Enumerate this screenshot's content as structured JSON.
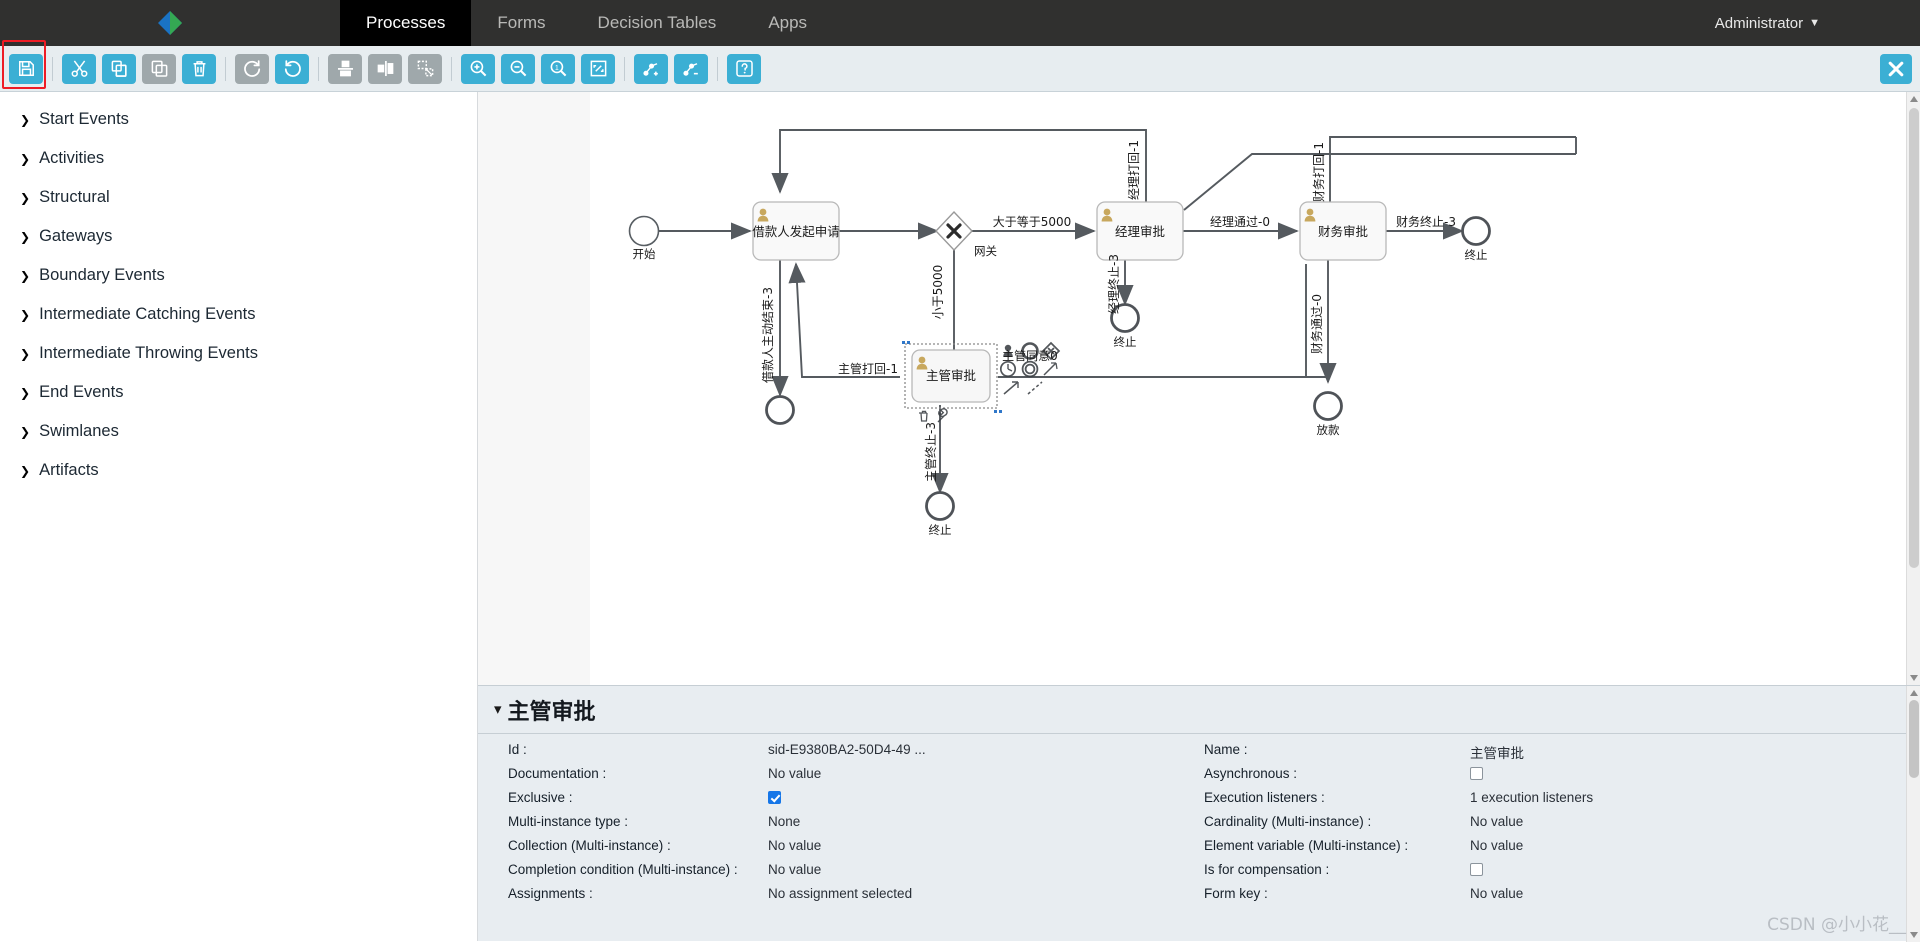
{
  "header": {
    "logo_icon": "diamond-logo-icon",
    "tabs": [
      {
        "label": "Processes",
        "active": true
      },
      {
        "label": "Forms",
        "active": false
      },
      {
        "label": "Decision Tables",
        "active": false
      },
      {
        "label": "Apps",
        "active": false
      }
    ],
    "user": "Administrator",
    "user_caret_icon": "chevron-down-icon"
  },
  "toolbar": {
    "buttons": [
      {
        "name": "save-button",
        "icon": "save-icon",
        "enabled": true,
        "title": "Save"
      },
      {
        "name": "cut-button",
        "icon": "scissors-icon",
        "enabled": true,
        "title": "Cut"
      },
      {
        "name": "copy-button",
        "icon": "copy-icon",
        "enabled": true,
        "title": "Copy"
      },
      {
        "name": "paste-button",
        "icon": "paste-icon",
        "enabled": false,
        "title": "Paste"
      },
      {
        "name": "delete-button",
        "icon": "trash-icon",
        "enabled": true,
        "title": "Delete"
      },
      {
        "name": "redo-button",
        "icon": "redo-icon",
        "enabled": false,
        "title": "Redo"
      },
      {
        "name": "undo-button",
        "icon": "undo-icon",
        "enabled": true,
        "title": "Undo"
      },
      {
        "name": "align-vertical-button",
        "icon": "align-vertical-icon",
        "enabled": false,
        "title": "Align vertical"
      },
      {
        "name": "align-horizontal-button",
        "icon": "align-horizontal-icon",
        "enabled": false,
        "title": "Align horizontal"
      },
      {
        "name": "same-size-button",
        "icon": "same-size-icon",
        "enabled": false,
        "title": "Same size"
      },
      {
        "name": "zoom-in-button",
        "icon": "zoom-in-icon",
        "enabled": true,
        "title": "Zoom in"
      },
      {
        "name": "zoom-out-button",
        "icon": "zoom-out-icon",
        "enabled": true,
        "title": "Zoom out"
      },
      {
        "name": "zoom-actual-button",
        "icon": "zoom-actual-icon",
        "enabled": true,
        "title": "Zoom actual size"
      },
      {
        "name": "zoom-fit-button",
        "icon": "zoom-fit-icon",
        "enabled": true,
        "title": "Zoom to fit"
      },
      {
        "name": "add-bendpoint-button",
        "icon": "add-bendpoint-icon",
        "enabled": true,
        "title": "Add bendpoint"
      },
      {
        "name": "remove-bendpoint-button",
        "icon": "remove-bendpoint-icon",
        "enabled": true,
        "title": "Remove bendpoint"
      },
      {
        "name": "help-button",
        "icon": "help-icon",
        "enabled": true,
        "title": "Help"
      }
    ],
    "close_icon": "close-icon",
    "save_highlight_color": "#ee1c25"
  },
  "palette": {
    "items": [
      {
        "label": "Start Events"
      },
      {
        "label": "Activities"
      },
      {
        "label": "Structural"
      },
      {
        "label": "Gateways"
      },
      {
        "label": "Boundary Events"
      },
      {
        "label": "Intermediate Catching Events"
      },
      {
        "label": "Intermediate Throwing Events"
      },
      {
        "label": "End Events"
      },
      {
        "label": "Swimlanes"
      },
      {
        "label": "Artifacts"
      }
    ],
    "arrow_icon": "chevron-right-icon"
  },
  "diagram": {
    "nodes": {
      "start": {
        "label": "开始",
        "type": "start-event"
      },
      "task_apply": {
        "label": "借款人发起申请",
        "type": "user-task"
      },
      "gateway": {
        "label": "网关",
        "type": "exclusive-gateway"
      },
      "task_manager": {
        "label": "经理审批",
        "type": "user-task"
      },
      "task_finance": {
        "label": "财务审批",
        "type": "user-task"
      },
      "task_supervisor": {
        "label": "主管审批",
        "type": "user-task",
        "selected": true
      },
      "end_apply": {
        "label": "",
        "type": "end-event"
      },
      "end_manager": {
        "label": "终止",
        "type": "end-event"
      },
      "end_finance": {
        "label": "终止",
        "type": "end-event"
      },
      "end_loan": {
        "label": "放款",
        "type": "end-event"
      },
      "end_supervisor": {
        "label": "终止",
        "type": "end-event"
      }
    },
    "flows": [
      {
        "label": "大于等于5000"
      },
      {
        "label": "小于5000"
      },
      {
        "label": "借款人主动结束-3"
      },
      {
        "label": "主管打回-1"
      },
      {
        "label": "主管同意0"
      },
      {
        "label": "主管终止-3"
      },
      {
        "label": "经理打回-1"
      },
      {
        "label": "经理通过-0"
      },
      {
        "label": "经理终止-3"
      },
      {
        "label": "财务打回-1"
      },
      {
        "label": "财务通过-0"
      },
      {
        "label": "财务终止-3"
      }
    ],
    "context_palette": {
      "icons": [
        "user-task-icon",
        "end-event-icon",
        "gateway-icon",
        "timer-event-icon",
        "intermediate-event-icon",
        "sequence-flow-icon",
        "association-icon",
        "dashed-association-icon",
        "delete-icon",
        "wrench-icon"
      ]
    }
  },
  "properties": {
    "title": "主管审批",
    "collapse_icon": "chevron-down-icon",
    "left": [
      {
        "label": "Id :",
        "value": "sid-E9380BA2-50D4-49 ...",
        "type": "text"
      },
      {
        "label": "Documentation :",
        "value": "No value",
        "type": "text"
      },
      {
        "label": "Exclusive :",
        "value": "",
        "type": "checkbox",
        "checked": true
      },
      {
        "label": "Multi-instance type :",
        "value": "None",
        "type": "text"
      },
      {
        "label": "Collection (Multi-instance) :",
        "value": "No value",
        "type": "text"
      },
      {
        "label": "Completion condition (Multi-instance) :",
        "value": "No value",
        "type": "text"
      },
      {
        "label": "Assignments :",
        "value": "No assignment selected",
        "type": "text"
      }
    ],
    "right": [
      {
        "label": "Name :",
        "value": "主管审批",
        "type": "text"
      },
      {
        "label": "Asynchronous :",
        "value": "",
        "type": "checkbox",
        "checked": false
      },
      {
        "label": "Execution listeners :",
        "value": "1 execution listeners",
        "type": "text"
      },
      {
        "label": "Cardinality (Multi-instance) :",
        "value": "No value",
        "type": "text"
      },
      {
        "label": "Element variable (Multi-instance) :",
        "value": "No value",
        "type": "text"
      },
      {
        "label": "Is for compensation :",
        "value": "",
        "type": "checkbox",
        "checked": false
      },
      {
        "label": "Form key :",
        "value": "No value",
        "type": "text"
      }
    ]
  },
  "watermark": "CSDN @小小花__"
}
